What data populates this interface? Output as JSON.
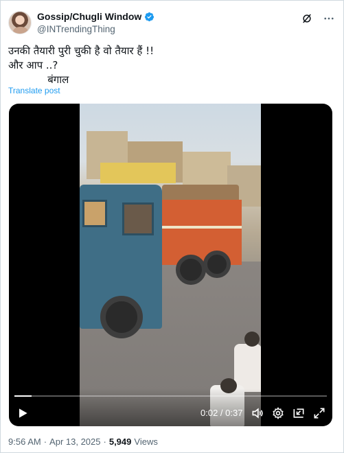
{
  "author": {
    "display_name": "Gossip/Chugli Window",
    "handle": "@INTrendingThing",
    "verified": true
  },
  "header_icons": [
    "grok-icon",
    "more-icon"
  ],
  "post": {
    "lines": [
      "उनकी तैयारी पुरी चुकी है वो तैयार हैं !!",
      "और आप ..?",
      "            बंगाल"
    ],
    "translate_label": "Translate post"
  },
  "video": {
    "current_time": "0:02",
    "duration": "0:37",
    "time_separator": " / ",
    "progress_fraction": 0.054
  },
  "meta": {
    "time": "9:56 AM",
    "date": "Apr 13, 2025",
    "views_count": "5,949",
    "views_label": "Views"
  },
  "colors": {
    "accent": "#1d9bf0",
    "muted_text": "#536471",
    "text": "#0f1419"
  }
}
